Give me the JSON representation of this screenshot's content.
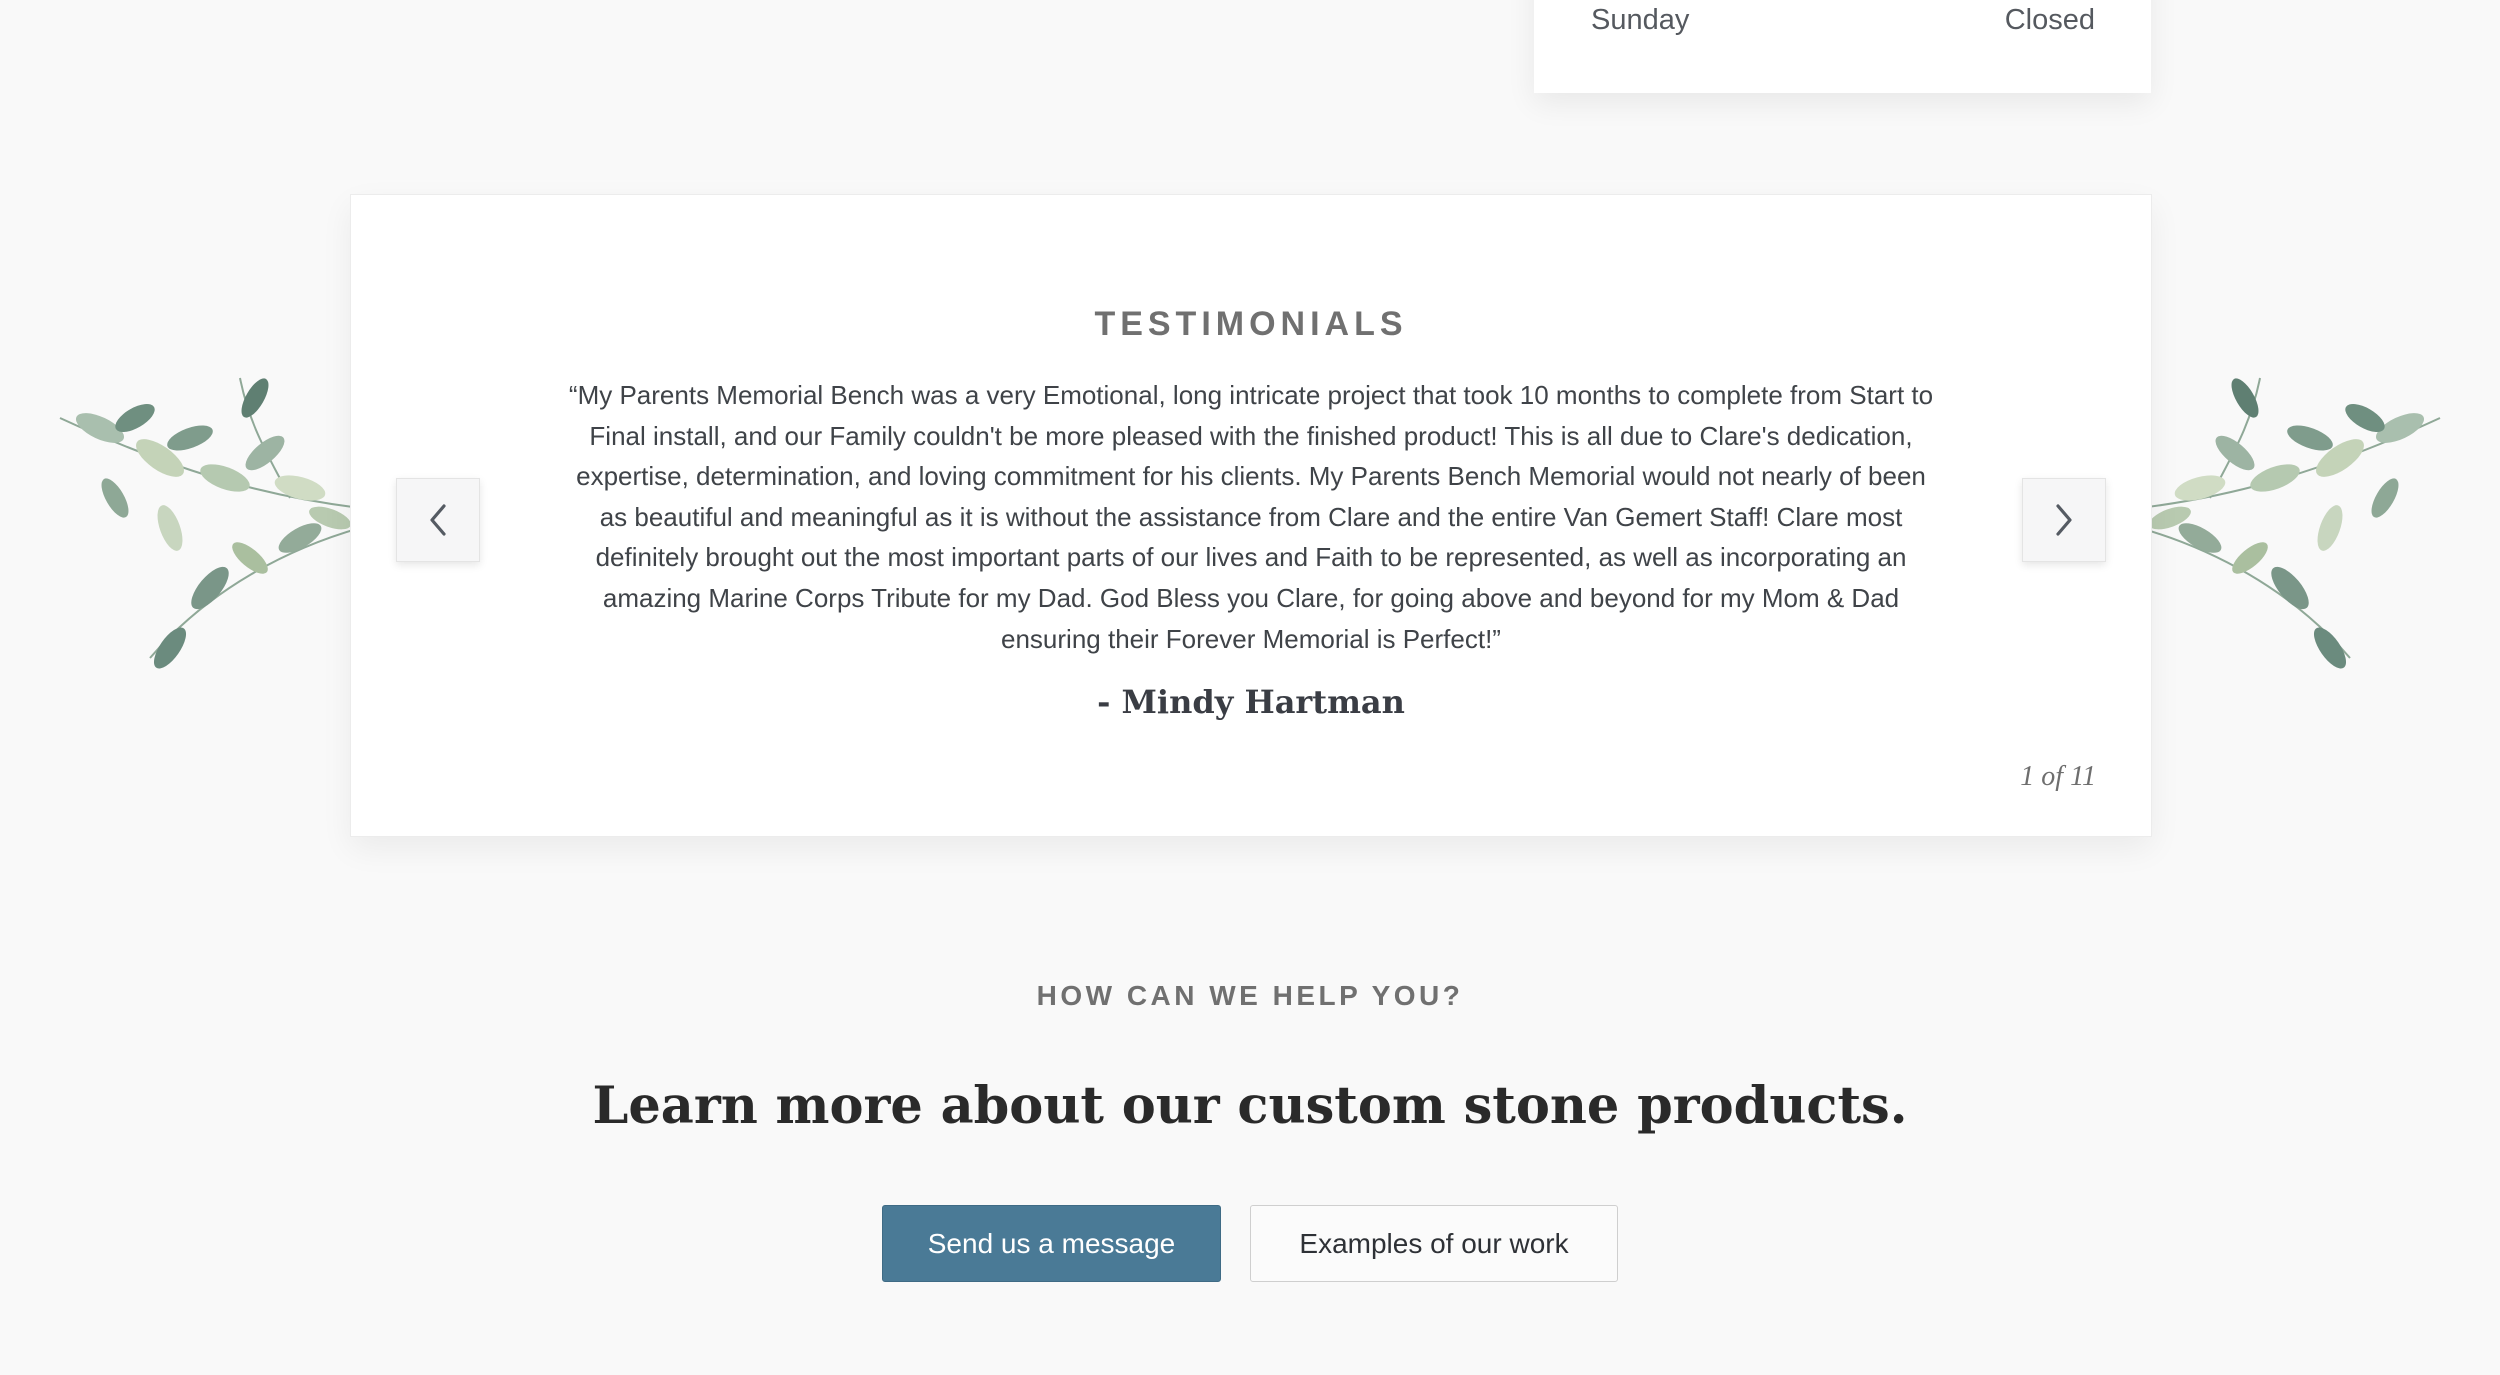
{
  "hours": {
    "day": "Sunday",
    "status": "Closed"
  },
  "testimonials": {
    "heading": "TESTIMONIALS",
    "quote": "“My Parents Memorial Bench was a very Emotional, long intricate project that took 10 months to complete from Start to Final install, and our Family couldn't be more pleased with the finished product! This is all due to Clare's dedication, expertise, determination, and loving commitment for his clients. My Parents Bench Memorial would not nearly of been as beautiful and meaningful as it is without the assistance from Clare and the entire Van Gemert Staff! Clare most definitely brought out the most important parts of our lives and Faith to be represented, as well as incorporating an amazing Marine Corps Tribute for my Dad. God Bless you Clare, for going above and beyond for my Mom & Dad ensuring their Forever Memorial is Perfect!”",
    "author": "- Mindy Hartman",
    "counter": "1 of 11",
    "prev_icon": "chevron-left-icon",
    "next_icon": "chevron-right-icon"
  },
  "help": {
    "eyebrow": "HOW CAN WE HELP YOU?",
    "title": "Learn more about our custom stone products.",
    "primary_button": "Send us a message",
    "secondary_button": "Examples of our work"
  },
  "colors": {
    "background": "#f9f9f9",
    "primary_button": "#4a7a96",
    "heading_gray": "#707070",
    "foliage_green": "#7f9c8c"
  }
}
